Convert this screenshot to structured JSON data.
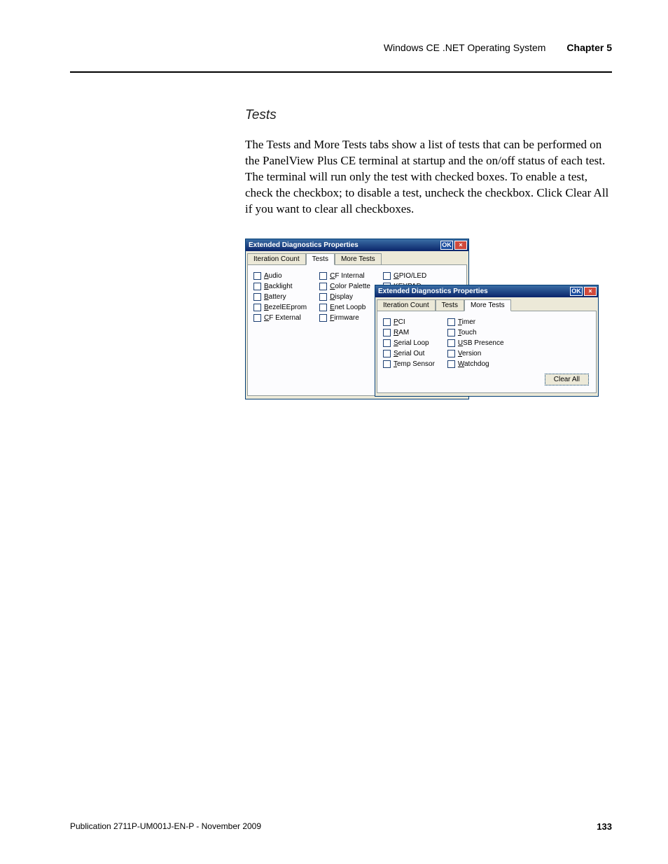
{
  "header": {
    "system": "Windows CE .NET Operating System",
    "chapter": "Chapter 5"
  },
  "section_heading": "Tests",
  "body_text": "The Tests and More Tests tabs show a list of tests that can be performed on the PanelView Plus CE terminal at startup and the on/off status of each test. The terminal will run only the test with checked boxes. To enable a test, check the checkbox; to disable a test, uncheck the checkbox. Click Clear All if you want to clear all checkboxes.",
  "dialog_title": "Extended Diagnostics Properties",
  "ok_label": "OK",
  "tabs": {
    "iteration": "Iteration Count",
    "tests": "Tests",
    "more_tests": "More Tests"
  },
  "tests_tab": {
    "col1": [
      "Audio",
      "Backlight",
      "Battery",
      "BezelEEprom",
      "CF External"
    ],
    "col2": [
      "CF Internal",
      "Color Palette",
      "Display",
      "Enet Loopb",
      "Firmware"
    ],
    "col3": [
      "GPIO/LED",
      "KEYPAD"
    ]
  },
  "more_tests_tab": {
    "col1": [
      "PCI",
      "RAM",
      "Serial Loop",
      "Serial Out",
      "Temp Sensor"
    ],
    "col2": [
      "Timer",
      "Touch",
      "USB Presence",
      "Version",
      "Watchdog"
    ]
  },
  "clear_all": "Clear All",
  "footer": {
    "pub": "Publication 2711P-UM001J-EN-P - November 2009",
    "page": "133"
  }
}
